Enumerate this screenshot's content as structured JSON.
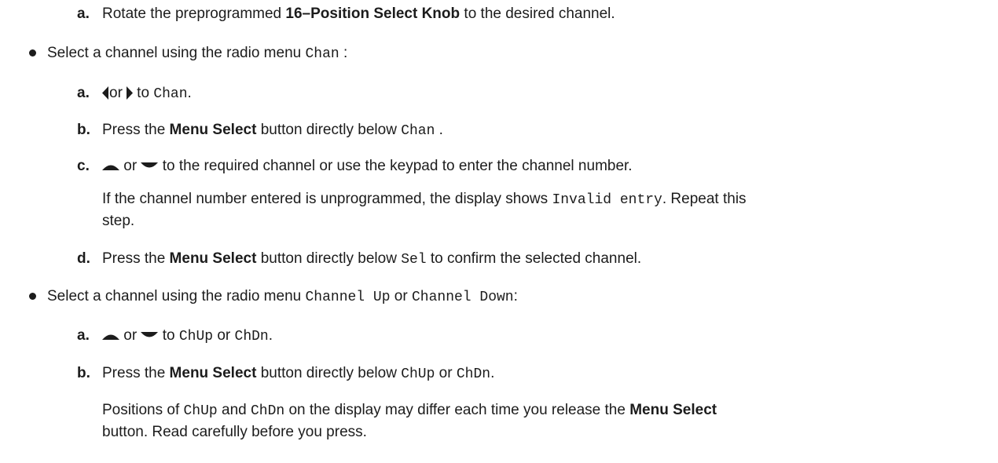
{
  "top_step": {
    "label": "a.",
    "text_1": "Rotate the preprogrammed ",
    "bold_1": "16–Position Select Knob",
    "text_2": " to the desired channel."
  },
  "bullet_1": {
    "text_1": "Select a channel using the radio menu ",
    "code_1": "Chan",
    "text_2": " :",
    "steps": {
      "a": {
        "label": "a.",
        "or": "or",
        "to": " to ",
        "code": "Chan",
        "end": "."
      },
      "b": {
        "label": "b.",
        "text_1": "Press the ",
        "bold": "Menu Select",
        "text_2": " button directly below ",
        "code": "Chan",
        "end": " ."
      },
      "c": {
        "label": "c.",
        "or": " or ",
        "text": " to the required channel or use the keypad to enter the channel number.",
        "note_1": "If the channel number entered is unprogrammed, the display shows ",
        "note_code": "Invalid entry",
        "note_2": ". Repeat this",
        "note_3": "step."
      },
      "d": {
        "label": "d.",
        "text_1": "Press the ",
        "bold": "Menu Select",
        "text_2": " button directly below ",
        "code": "Sel",
        "text_3": " to confirm the selected channel."
      }
    }
  },
  "bullet_2": {
    "text_1": "Select a channel using the radio menu ",
    "code_1": "Channel Up",
    "or": " or ",
    "code_2": "Channel Down",
    "end": ":",
    "steps": {
      "a": {
        "label": "a.",
        "or": " or ",
        "to": " to ",
        "code_1": "ChUp",
        "or2": " or ",
        "code_2": "ChDn",
        "end": "."
      },
      "b": {
        "label": "b.",
        "text_1": "Press the ",
        "bold": "Menu Select",
        "text_2": " button directly below ",
        "code_1": "ChUp",
        "or": " or ",
        "code_2": "ChDn",
        "end": ".",
        "note_1": "Positions of ",
        "note_code_1": "ChUp",
        "note_and": " and ",
        "note_code_2": "ChDn",
        "note_2": " on the display may differ each time you release the ",
        "note_bold": "Menu Select",
        "note_3": "button. Read carefully before you press."
      }
    }
  },
  "icons": {
    "left": "left-arrow-icon",
    "right": "right-arrow-icon",
    "up": "up-arrow-icon",
    "down": "down-arrow-icon"
  }
}
